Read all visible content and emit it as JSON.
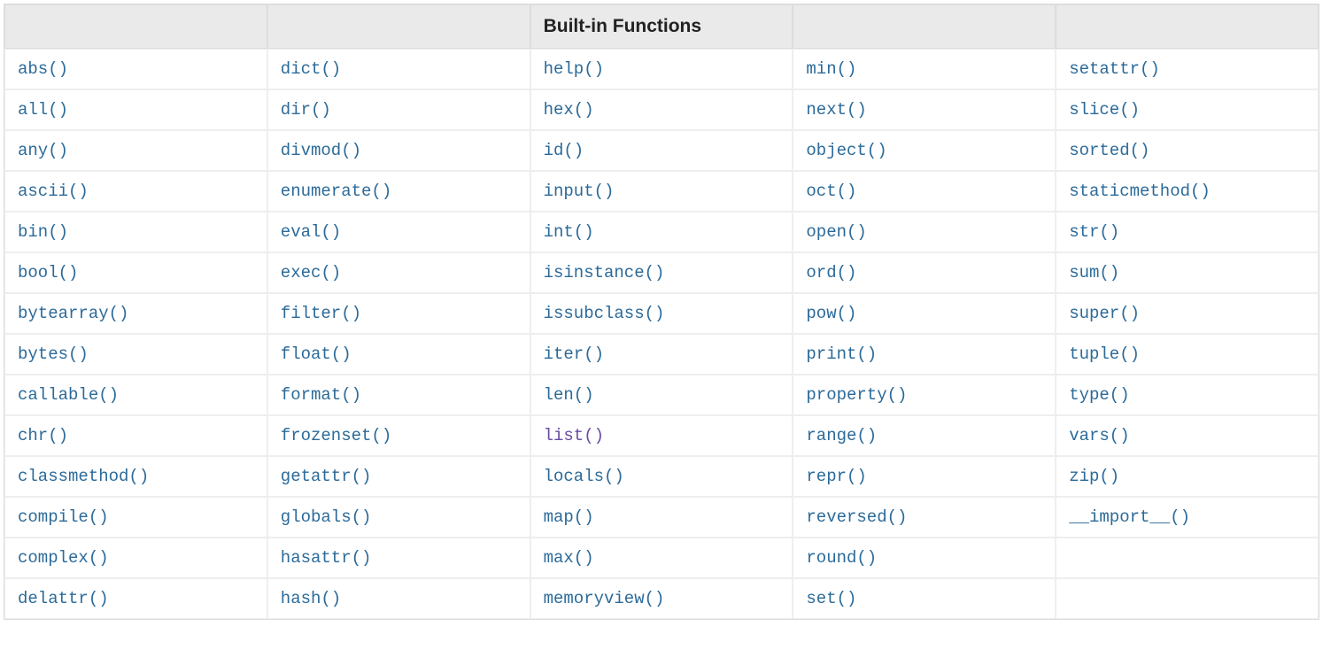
{
  "table": {
    "headers": [
      "",
      "",
      "Built-in Functions",
      "",
      ""
    ],
    "rows": [
      [
        {
          "text": "abs()",
          "visited": false
        },
        {
          "text": "dict()",
          "visited": false
        },
        {
          "text": "help()",
          "visited": false
        },
        {
          "text": "min()",
          "visited": false
        },
        {
          "text": "setattr()",
          "visited": false
        }
      ],
      [
        {
          "text": "all()",
          "visited": false
        },
        {
          "text": "dir()",
          "visited": false
        },
        {
          "text": "hex()",
          "visited": false
        },
        {
          "text": "next()",
          "visited": false
        },
        {
          "text": "slice()",
          "visited": false
        }
      ],
      [
        {
          "text": "any()",
          "visited": false
        },
        {
          "text": "divmod()",
          "visited": false
        },
        {
          "text": "id()",
          "visited": false
        },
        {
          "text": "object()",
          "visited": false
        },
        {
          "text": "sorted()",
          "visited": false
        }
      ],
      [
        {
          "text": "ascii()",
          "visited": false
        },
        {
          "text": "enumerate()",
          "visited": false
        },
        {
          "text": "input()",
          "visited": false
        },
        {
          "text": "oct()",
          "visited": false
        },
        {
          "text": "staticmethod()",
          "visited": false
        }
      ],
      [
        {
          "text": "bin()",
          "visited": false
        },
        {
          "text": "eval()",
          "visited": false
        },
        {
          "text": "int()",
          "visited": false
        },
        {
          "text": "open()",
          "visited": false
        },
        {
          "text": "str()",
          "visited": false
        }
      ],
      [
        {
          "text": "bool()",
          "visited": false
        },
        {
          "text": "exec()",
          "visited": false
        },
        {
          "text": "isinstance()",
          "visited": false
        },
        {
          "text": "ord()",
          "visited": false
        },
        {
          "text": "sum()",
          "visited": false
        }
      ],
      [
        {
          "text": "bytearray()",
          "visited": false
        },
        {
          "text": "filter()",
          "visited": false
        },
        {
          "text": "issubclass()",
          "visited": false
        },
        {
          "text": "pow()",
          "visited": false
        },
        {
          "text": "super()",
          "visited": false
        }
      ],
      [
        {
          "text": "bytes()",
          "visited": false
        },
        {
          "text": "float()",
          "visited": false
        },
        {
          "text": "iter()",
          "visited": false
        },
        {
          "text": "print()",
          "visited": false
        },
        {
          "text": "tuple()",
          "visited": false
        }
      ],
      [
        {
          "text": "callable()",
          "visited": false
        },
        {
          "text": "format()",
          "visited": false
        },
        {
          "text": "len()",
          "visited": false
        },
        {
          "text": "property()",
          "visited": false
        },
        {
          "text": "type()",
          "visited": false
        }
      ],
      [
        {
          "text": "chr()",
          "visited": false
        },
        {
          "text": "frozenset()",
          "visited": false
        },
        {
          "text": "list()",
          "visited": true
        },
        {
          "text": "range()",
          "visited": false
        },
        {
          "text": "vars()",
          "visited": false
        }
      ],
      [
        {
          "text": "classmethod()",
          "visited": false
        },
        {
          "text": "getattr()",
          "visited": false
        },
        {
          "text": "locals()",
          "visited": false
        },
        {
          "text": "repr()",
          "visited": false
        },
        {
          "text": "zip()",
          "visited": false
        }
      ],
      [
        {
          "text": "compile()",
          "visited": false
        },
        {
          "text": "globals()",
          "visited": false
        },
        {
          "text": "map()",
          "visited": false
        },
        {
          "text": "reversed()",
          "visited": false
        },
        {
          "text": "__import__()",
          "visited": false
        }
      ],
      [
        {
          "text": "complex()",
          "visited": false
        },
        {
          "text": "hasattr()",
          "visited": false
        },
        {
          "text": "max()",
          "visited": false
        },
        {
          "text": "round()",
          "visited": false
        },
        {
          "text": "",
          "visited": false
        }
      ],
      [
        {
          "text": "delattr()",
          "visited": false
        },
        {
          "text": "hash()",
          "visited": false
        },
        {
          "text": "memoryview()",
          "visited": false
        },
        {
          "text": "set()",
          "visited": false
        },
        {
          "text": "",
          "visited": false
        }
      ]
    ]
  }
}
